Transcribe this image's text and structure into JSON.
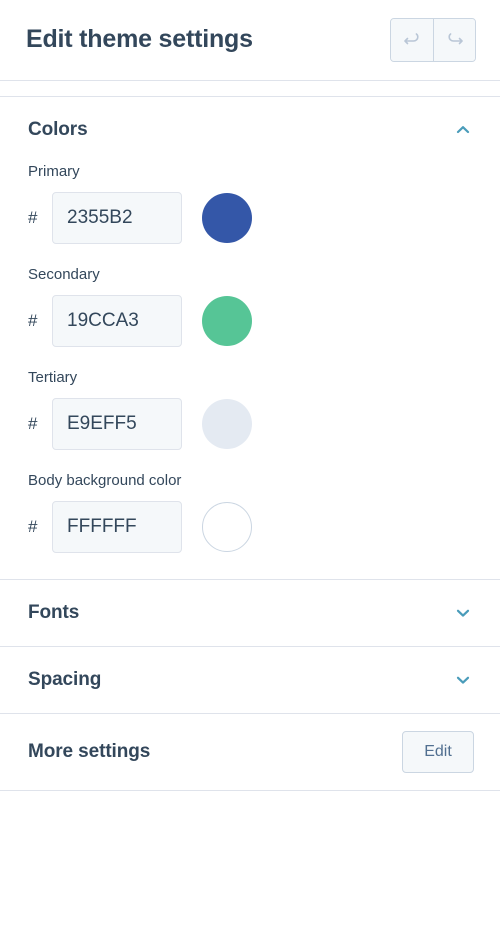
{
  "header": {
    "title": "Edit theme settings",
    "undo_icon": "undo-arrow-icon",
    "redo_icon": "redo-arrow-icon"
  },
  "sections": {
    "colors": {
      "title": "Colors",
      "expanded": true,
      "chevron_icon": "chevron-up-icon",
      "fields": [
        {
          "label": "Primary",
          "hash": "#",
          "value": "2355B2",
          "swatch_color": "#3457a8",
          "swatch_bordered": false
        },
        {
          "label": "Secondary",
          "hash": "#",
          "value": "19CCA3",
          "swatch_color": "#56c596",
          "swatch_bordered": false
        },
        {
          "label": "Tertiary",
          "hash": "#",
          "value": "E9EFF5",
          "swatch_color": "#e4eaf2",
          "swatch_bordered": false
        },
        {
          "label": "Body background color",
          "hash": "#",
          "value": "FFFFFF",
          "swatch_color": "#ffffff",
          "swatch_bordered": true
        }
      ]
    },
    "fonts": {
      "title": "Fonts",
      "expanded": false,
      "chevron_icon": "chevron-down-icon"
    },
    "spacing": {
      "title": "Spacing",
      "expanded": false,
      "chevron_icon": "chevron-down-icon"
    },
    "more": {
      "title": "More settings",
      "edit_label": "Edit"
    }
  },
  "colors": {
    "text_dark": "#33475b",
    "chevron_teal": "#4a9cba",
    "divider": "#dfe3eb",
    "input_bg": "#f5f8fa",
    "input_border": "#dfe3eb"
  }
}
